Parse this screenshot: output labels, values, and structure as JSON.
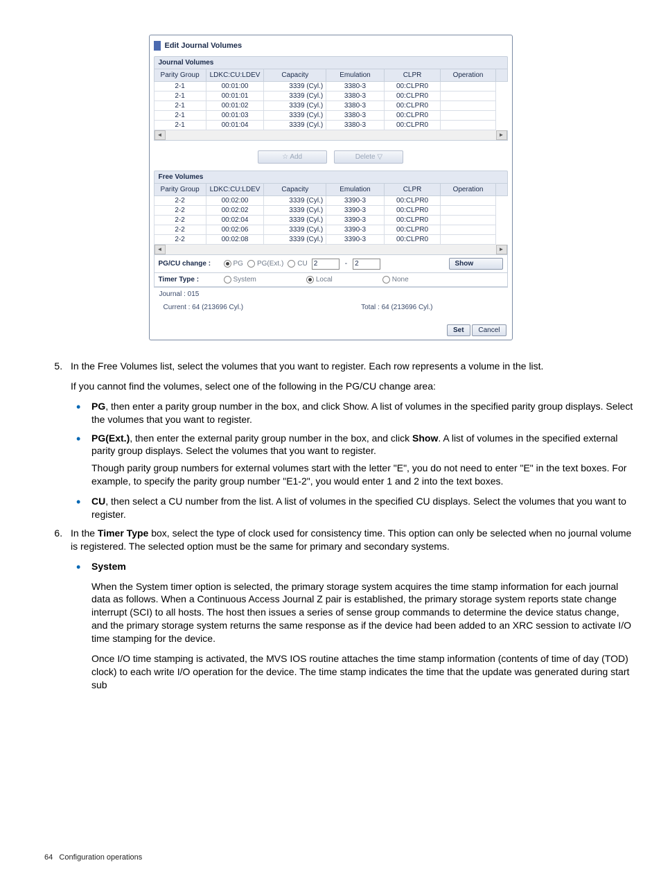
{
  "dialog": {
    "title": "Edit Journal Volumes",
    "journal_section": "Journal Volumes",
    "free_section": "Free Volumes",
    "columns": [
      "Parity Group",
      "LDKC:CU:LDEV",
      "Capacity",
      "Emulation",
      "CLPR",
      "Operation"
    ],
    "journal_rows": [
      {
        "pg": "2-1",
        "ldev": "00:01:00",
        "cap": "3339 (Cyl.)",
        "emu": "3380-3",
        "clpr": "00:CLPR0"
      },
      {
        "pg": "2-1",
        "ldev": "00:01:01",
        "cap": "3339 (Cyl.)",
        "emu": "3380-3",
        "clpr": "00:CLPR0"
      },
      {
        "pg": "2-1",
        "ldev": "00:01:02",
        "cap": "3339 (Cyl.)",
        "emu": "3380-3",
        "clpr": "00:CLPR0"
      },
      {
        "pg": "2-1",
        "ldev": "00:01:03",
        "cap": "3339 (Cyl.)",
        "emu": "3380-3",
        "clpr": "00:CLPR0"
      },
      {
        "pg": "2-1",
        "ldev": "00:01:04",
        "cap": "3339 (Cyl.)",
        "emu": "3380-3",
        "clpr": "00:CLPR0"
      }
    ],
    "free_rows": [
      {
        "pg": "2-2",
        "ldev": "00:02:00",
        "cap": "3339 (Cyl.)",
        "emu": "3390-3",
        "clpr": "00:CLPR0"
      },
      {
        "pg": "2-2",
        "ldev": "00:02:02",
        "cap": "3339 (Cyl.)",
        "emu": "3390-3",
        "clpr": "00:CLPR0"
      },
      {
        "pg": "2-2",
        "ldev": "00:02:04",
        "cap": "3339 (Cyl.)",
        "emu": "3390-3",
        "clpr": "00:CLPR0"
      },
      {
        "pg": "2-2",
        "ldev": "00:02:06",
        "cap": "3339 (Cyl.)",
        "emu": "3390-3",
        "clpr": "00:CLPR0"
      },
      {
        "pg": "2-2",
        "ldev": "00:02:08",
        "cap": "3339 (Cyl.)",
        "emu": "3390-3",
        "clpr": "00:CLPR0"
      }
    ],
    "add_label": "Add",
    "delete_label": "Delete",
    "pgcu": {
      "label": "PG/CU change :",
      "pg": "PG",
      "pgext": "PG(Ext.)",
      "cu": "CU",
      "v1": "2",
      "v2": "2",
      "show": "Show"
    },
    "timer": {
      "label": "Timer Type :",
      "system": "System",
      "local": "Local",
      "none": "None"
    },
    "journal_info": "Journal : 015",
    "current": "Current : 64 (213696 Cyl.)",
    "total": "Total : 64 (213696 Cyl.)",
    "set": "Set",
    "cancel": "Cancel"
  },
  "doc": {
    "step5_num": "5.",
    "step5_p1": "In the Free Volumes list, select the volumes that you want to register. Each row represents a volume in the list.",
    "step5_p2": "If you cannot find the volumes, select one of the following in the PG/CU change area:",
    "b_pg": "PG",
    "b_pg_t": ", then enter a parity group number in the box, and click Show. A list of volumes in the specified parity group displays. Select the volumes that you want to register.",
    "b_pgext": "PG(Ext.)",
    "b_pgext_t1": ", then enter the external parity group number in the box, and click ",
    "b_show": "Show",
    "b_pgext_t2": ". A list of volumes in the specified external parity group displays. Select the volumes that you want to register.",
    "b_pgext_p2": "Though parity group numbers for external volumes start with the letter \"E\", you do not need to enter \"E\" in the text boxes. For example, to specify the parity group number \"E1-2\", you would enter 1 and 2 into the text boxes.",
    "b_cu": "CU",
    "b_cu_t": ", then select a CU number from the list. A list of volumes in the specified CU displays. Select the volumes that you want to register.",
    "step6_num": "6.",
    "step6_p1a": "In the ",
    "step6_b_timer": "Timer Type",
    "step6_p1b": " box, select the type of clock used for consistency time. This option can only be selected when no journal volume is registered. The selected option must be the same for primary and secondary systems.",
    "b_system": "System",
    "b_system_p1": "When the System timer option is selected, the primary storage system acquires the time stamp information for each journal data as follows. When a Continuous Access Journal Z pair is established, the primary storage system reports state change interrupt (SCI) to all hosts. The host then issues a series of sense group commands to determine the device status change, and the primary storage system returns the same response as if the device had been added to an XRC session to activate I/O time stamping for the device.",
    "b_system_p2": "Once I/O time stamping is activated, the MVS IOS routine attaches the time stamp information (contents of time of day (TOD) clock) to each write I/O operation for the device. The time stamp indicates the time that the update was generated during start sub"
  },
  "footer": {
    "page": "64",
    "section": "Configuration operations"
  }
}
